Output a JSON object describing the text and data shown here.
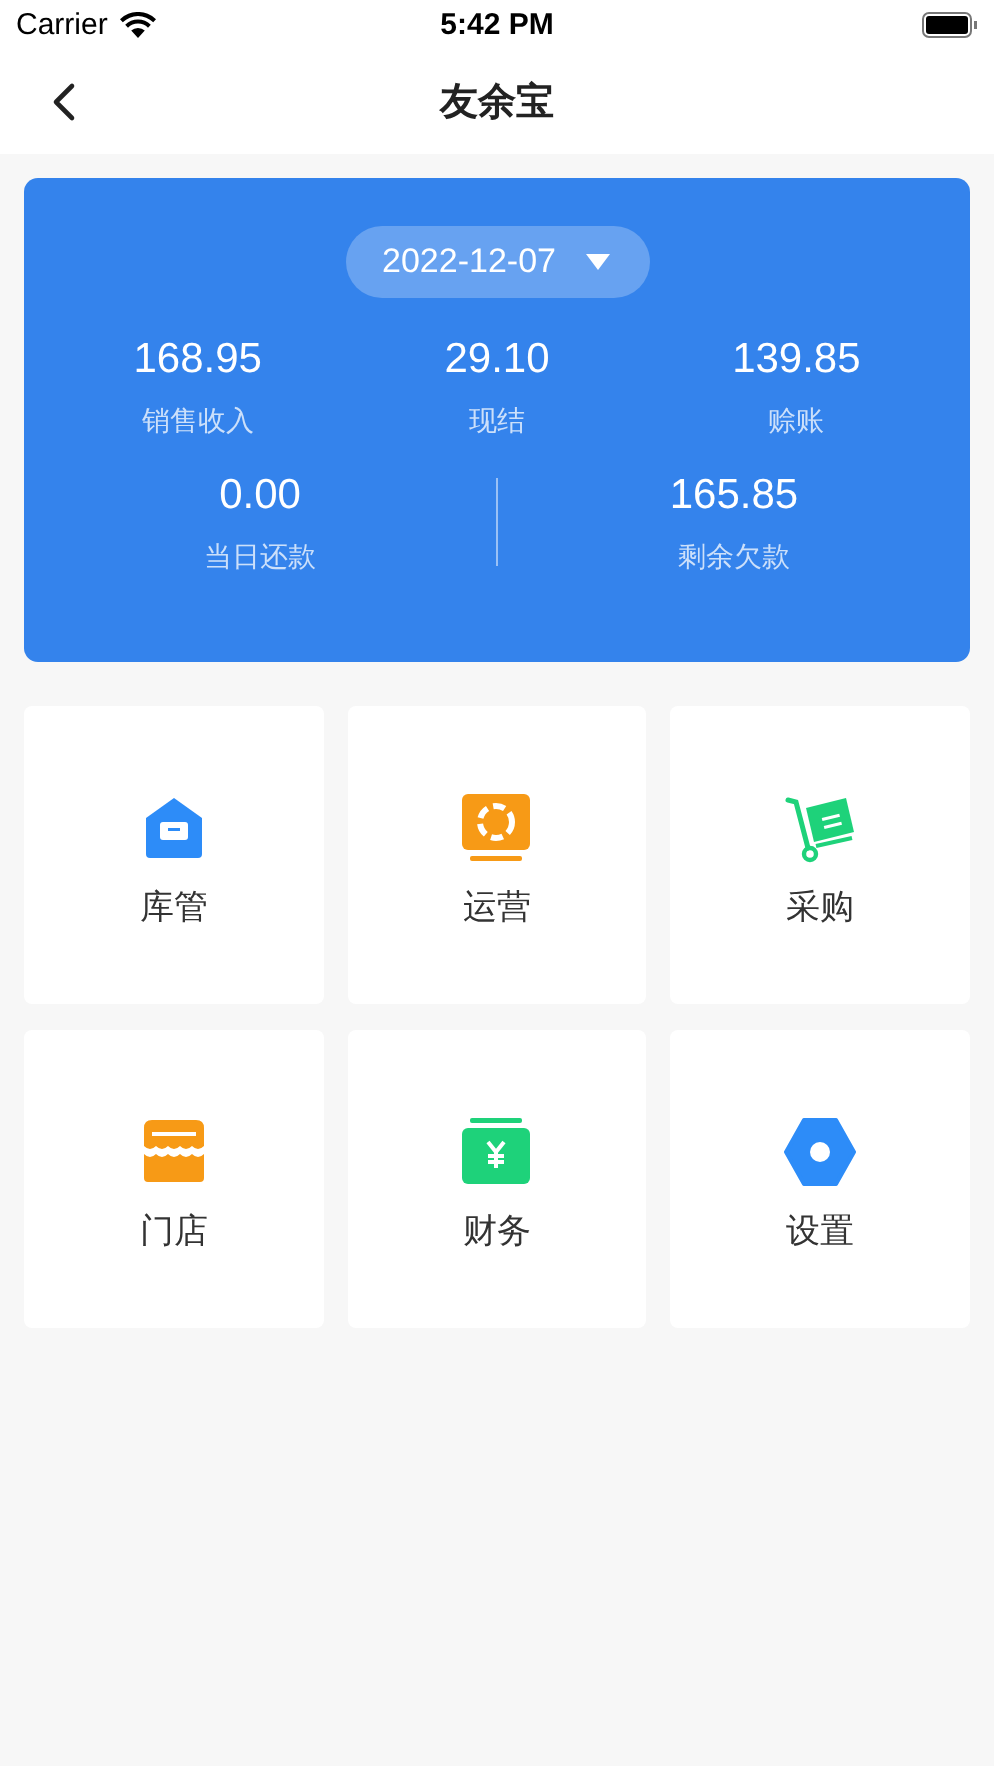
{
  "status_bar": {
    "carrier": "Carrier",
    "time": "5:42 PM"
  },
  "nav": {
    "title": "友余宝"
  },
  "summary": {
    "date": "2022-12-07",
    "top_stats": [
      {
        "value": "168.95",
        "label": "销售收入"
      },
      {
        "value": "29.10",
        "label": "现结"
      },
      {
        "value": "139.85",
        "label": "赊账"
      }
    ],
    "bottom_stats": [
      {
        "value": "0.00",
        "label": "当日还款"
      },
      {
        "value": "165.85",
        "label": "剩余欠款"
      }
    ]
  },
  "menu": [
    {
      "kind": "warehouse",
      "label": "库管"
    },
    {
      "kind": "operations",
      "label": "运营"
    },
    {
      "kind": "purchase",
      "label": "采购"
    },
    {
      "kind": "store",
      "label": "门店"
    },
    {
      "kind": "finance",
      "label": "财务"
    },
    {
      "kind": "settings",
      "label": "设置"
    }
  ]
}
